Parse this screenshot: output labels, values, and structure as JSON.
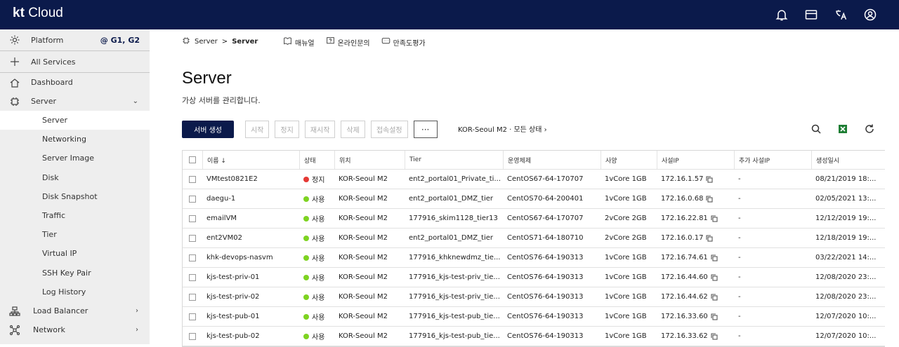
{
  "app": {
    "logo_kt": "kt",
    "logo_cloud": "Cloud"
  },
  "topbar_icons": [
    "bell-icon",
    "card-icon",
    "language-icon",
    "user-icon"
  ],
  "sidebar": {
    "platform_label": "Platform",
    "platform_tag": "@ G1, G2",
    "all_services": "All Services",
    "dashboard": "Dashboard",
    "server": "Server",
    "server_items": [
      "Server",
      "Networking",
      "Server Image",
      "Disk",
      "Disk Snapshot",
      "Traffic",
      "Tier",
      "Virtual IP",
      "SSH Key Pair",
      "Log History"
    ],
    "load_balancer": "Load Balancer",
    "network": "Network"
  },
  "breadcrumb": {
    "parent": "Server",
    "separator": ">",
    "current": "Server"
  },
  "toplinks": {
    "manual": "매뉴얼",
    "inquiry": "온라인문의",
    "survey": "만족도평가"
  },
  "page": {
    "title": "Server",
    "subtitle": "가상 서버를 관리합니다."
  },
  "actions": {
    "create": "서버 생성",
    "start": "시작",
    "stop": "정지",
    "restart": "재시작",
    "delete": "삭제",
    "access": "접속설정",
    "more": "···"
  },
  "region_filter": "KOR-Seoul M2 · 모든 상태 ›",
  "table": {
    "headers": {
      "name": "이름 ↓",
      "status": "상태",
      "location": "위치",
      "tier": "Tier",
      "os": "운영체제",
      "spec": "사양",
      "private_ip": "사설IP",
      "extra_ip": "추가 사설IP",
      "created": "생성일시"
    },
    "status_colors": {
      "정지": "#e53935",
      "사용": "#7ed321"
    },
    "rows": [
      {
        "name": "VMtest0821E2",
        "status": "정지",
        "location": "KOR-Seoul M2",
        "tier": "ent2_portal01_Private_ti...",
        "os": "CentOS67-64-170707",
        "spec": "1vCore 1GB",
        "ip": "172.16.1.57",
        "extra": "-",
        "created": "08/21/2019 18:..."
      },
      {
        "name": "daegu-1",
        "status": "사용",
        "location": "KOR-Seoul M2",
        "tier": "ent2_portal01_DMZ_tier",
        "os": "CentOS70-64-200401",
        "spec": "1vCore 1GB",
        "ip": "172.16.0.68",
        "extra": "-",
        "created": "02/05/2021 13:..."
      },
      {
        "name": "emailVM",
        "status": "사용",
        "location": "KOR-Seoul M2",
        "tier": "177916_skim1128_tier13",
        "os": "CentOS67-64-170707",
        "spec": "2vCore 2GB",
        "ip": "172.16.22.81",
        "extra": "-",
        "created": "12/12/2019 19:..."
      },
      {
        "name": "ent2VM02",
        "status": "사용",
        "location": "KOR-Seoul M2",
        "tier": "ent2_portal01_DMZ_tier",
        "os": "CentOS71-64-180710",
        "spec": "2vCore 2GB",
        "ip": "172.16.0.17",
        "extra": "-",
        "created": "12/18/2019 19:..."
      },
      {
        "name": "khk-devops-nasvm",
        "status": "사용",
        "location": "KOR-Seoul M2",
        "tier": "177916_khknewdmz_tie...",
        "os": "CentOS76-64-190313",
        "spec": "1vCore 1GB",
        "ip": "172.16.74.61",
        "extra": "-",
        "created": "03/22/2021 14:..."
      },
      {
        "name": "kjs-test-priv-01",
        "status": "사용",
        "location": "KOR-Seoul M2",
        "tier": "177916_kjs-test-priv_tie...",
        "os": "CentOS76-64-190313",
        "spec": "1vCore 1GB",
        "ip": "172.16.44.60",
        "extra": "-",
        "created": "12/08/2020 23:..."
      },
      {
        "name": "kjs-test-priv-02",
        "status": "사용",
        "location": "KOR-Seoul M2",
        "tier": "177916_kjs-test-priv_tie...",
        "os": "CentOS76-64-190313",
        "spec": "1vCore 1GB",
        "ip": "172.16.44.62",
        "extra": "-",
        "created": "12/08/2020 23:..."
      },
      {
        "name": "kjs-test-pub-01",
        "status": "사용",
        "location": "KOR-Seoul M2",
        "tier": "177916_kjs-test-pub_tie...",
        "os": "CentOS76-64-190313",
        "spec": "1vCore 1GB",
        "ip": "172.16.33.60",
        "extra": "-",
        "created": "12/07/2020 10:..."
      },
      {
        "name": "kjs-test-pub-02",
        "status": "사용",
        "location": "KOR-Seoul M2",
        "tier": "177916_kjs-test-pub_tie...",
        "os": "CentOS76-64-190313",
        "spec": "1vCore 1GB",
        "ip": "172.16.33.62",
        "extra": "-",
        "created": "12/07/2020 10:..."
      }
    ]
  }
}
